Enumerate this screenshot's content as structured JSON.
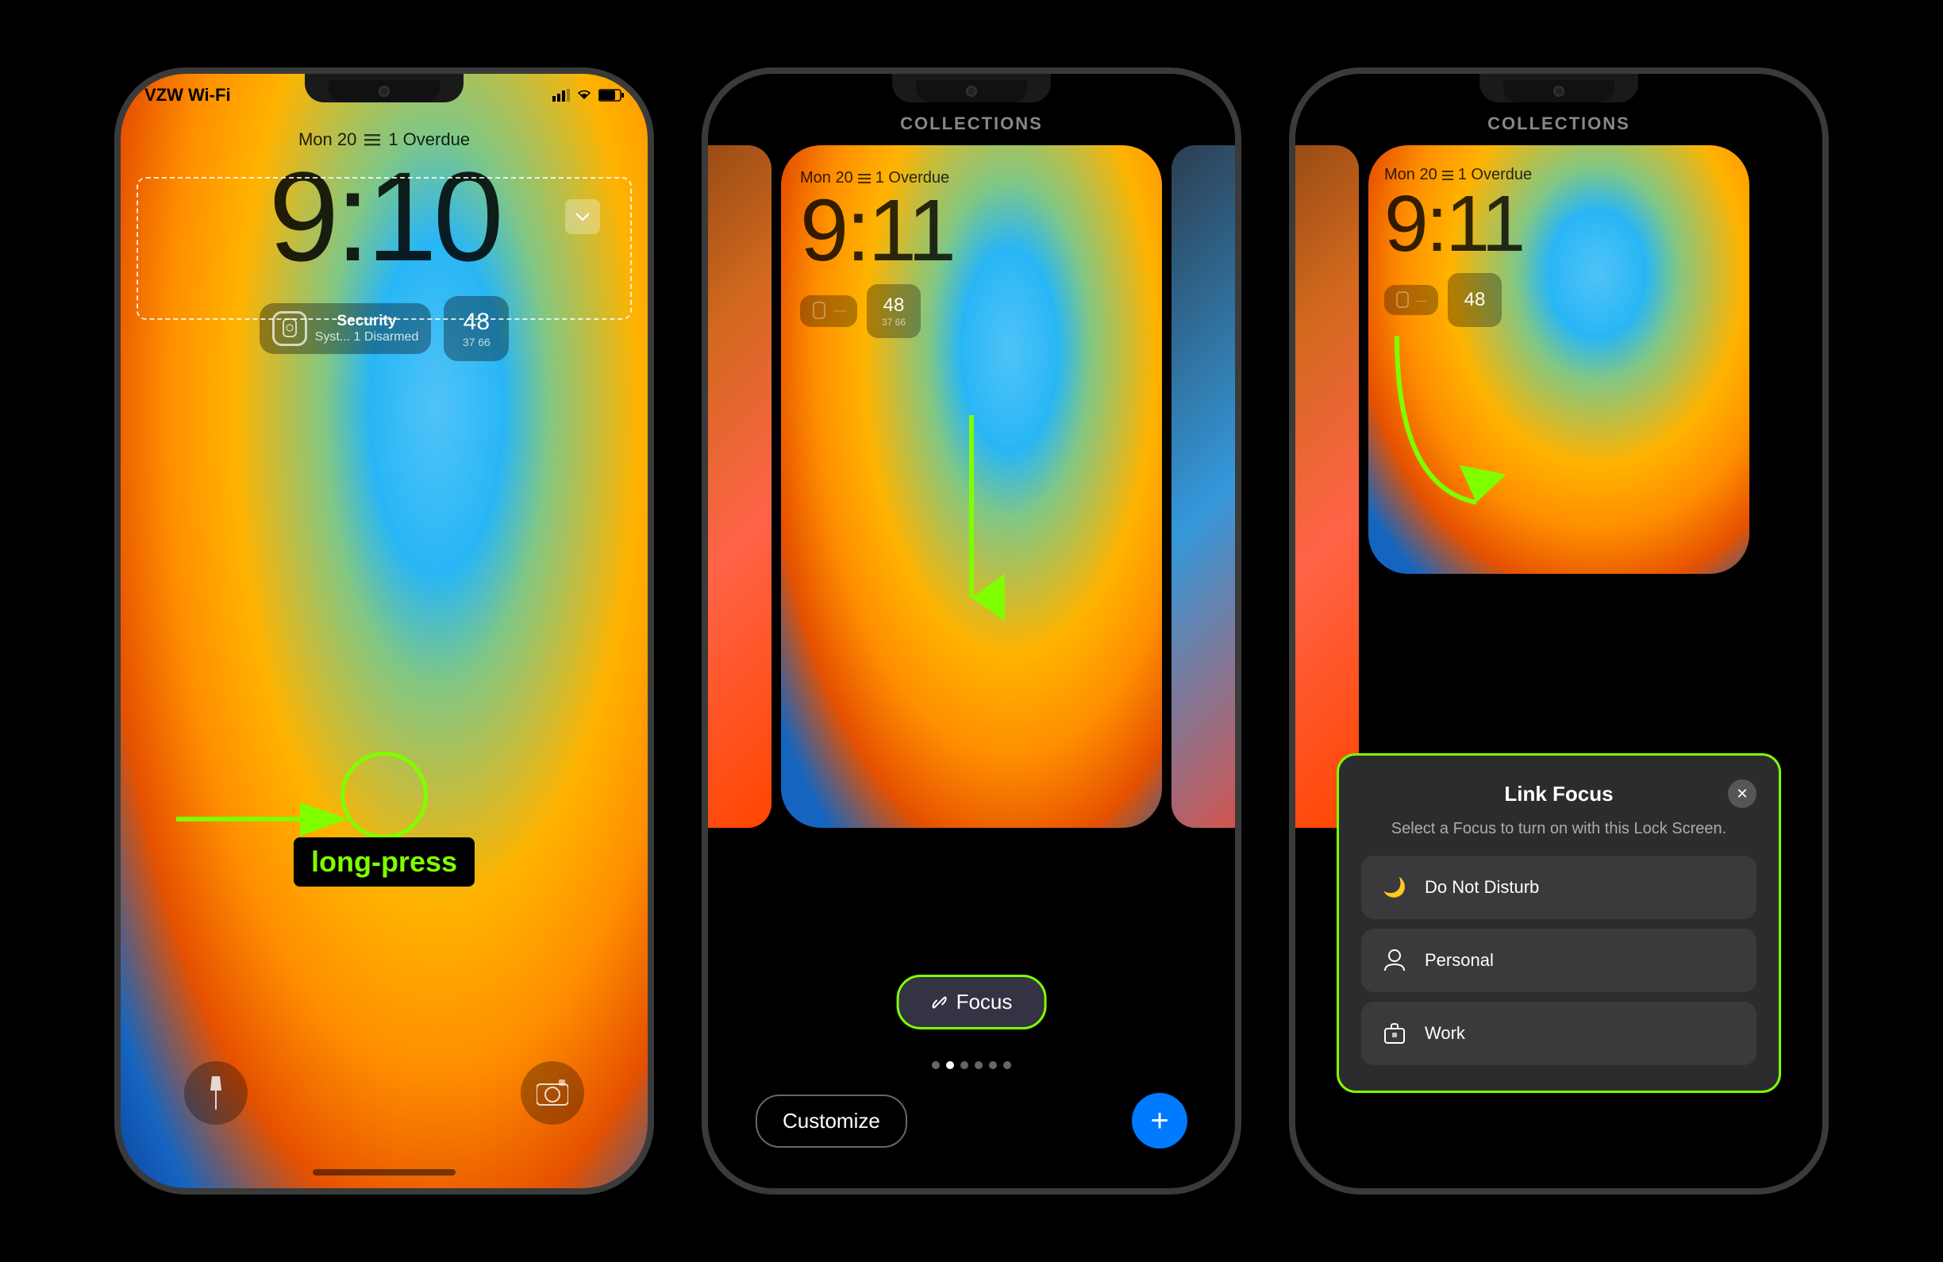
{
  "phone1": {
    "carrier": "VZW Wi-Fi",
    "date": "Mon 20",
    "overdue": "1 Overdue",
    "time": "9:10",
    "widget_security_title": "Security",
    "widget_security_sub": "Syst... 1 Disarmed",
    "widget_temp": "48",
    "widget_temp_range": "37 66",
    "long_press_label": "long-press",
    "annotation_arrow": "→"
  },
  "phone2": {
    "header": "COLLECTIONS",
    "date": "Mon 20",
    "overdue": "1 Overdue",
    "time": "9:11",
    "widget_temp": "48",
    "widget_temp_range": "37 66",
    "focus_btn": "Focus",
    "customize_btn": "Customize",
    "add_btn": "+"
  },
  "phone3": {
    "header": "COLLECTIONS",
    "date": "Mon 20",
    "overdue": "1 Overdue",
    "time": "9:11",
    "widget_temp": "48",
    "link_focus_title": "Link Focus",
    "link_focus_subtitle": "Select a Focus to turn on with this Lock Screen.",
    "close_btn": "✕",
    "options": [
      {
        "icon": "🌙",
        "label": "Do Not Disturb"
      },
      {
        "icon": "👤",
        "label": "Personal"
      },
      {
        "icon": "🪪",
        "label": "Work"
      }
    ]
  }
}
